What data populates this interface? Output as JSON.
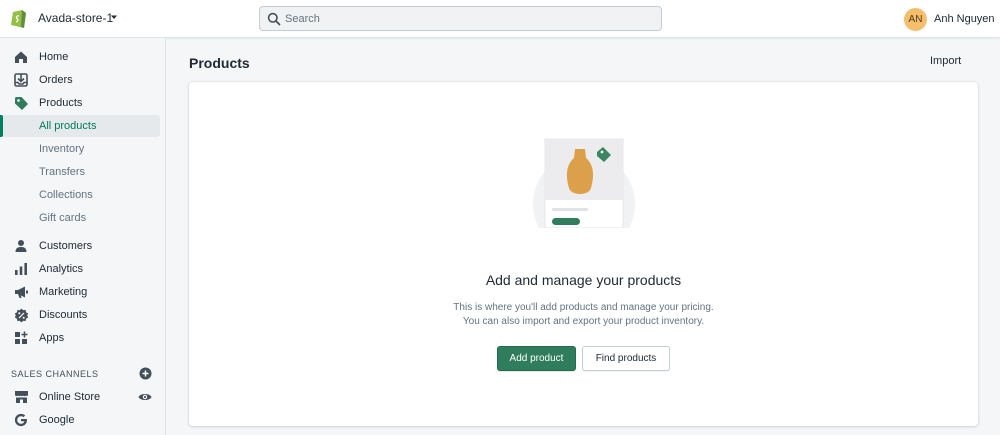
{
  "header": {
    "store_name": "Avada-store-1",
    "search": {
      "placeholder": "Search",
      "value": ""
    },
    "user": {
      "initials": "AN",
      "name": "Anh Nguyen"
    }
  },
  "sidebar": {
    "items": [
      {
        "label": "Home",
        "icon": "home-icon"
      },
      {
        "label": "Orders",
        "icon": "orders-icon"
      },
      {
        "label": "Products",
        "icon": "tag-icon"
      }
    ],
    "product_subitems": [
      {
        "label": "All products",
        "active": true
      },
      {
        "label": "Inventory"
      },
      {
        "label": "Transfers"
      },
      {
        "label": "Collections"
      },
      {
        "label": "Gift cards"
      }
    ],
    "items2": [
      {
        "label": "Customers",
        "icon": "customer-icon"
      },
      {
        "label": "Analytics",
        "icon": "analytics-icon"
      },
      {
        "label": "Marketing",
        "icon": "megaphone-icon"
      },
      {
        "label": "Discounts",
        "icon": "discount-icon"
      },
      {
        "label": "Apps",
        "icon": "apps-icon"
      }
    ],
    "sales_channels_title": "SALES CHANNELS",
    "channels": [
      {
        "label": "Online Store",
        "icon": "store-icon"
      },
      {
        "label": "Google",
        "icon": "google-icon"
      }
    ]
  },
  "main": {
    "title": "Products",
    "import_label": "Import",
    "empty_state": {
      "heading": "Add and manage your products",
      "line1": "This is where you'll add products and manage your pricing.",
      "line2": "You can also import and export your product inventory.",
      "primary_action": "Add product",
      "secondary_action": "Find products"
    }
  },
  "colors": {
    "accent": "#008060",
    "primary_button": "#2f7d5c",
    "avatar": "#f4be6c",
    "illustration_vase": "#dca04a"
  }
}
